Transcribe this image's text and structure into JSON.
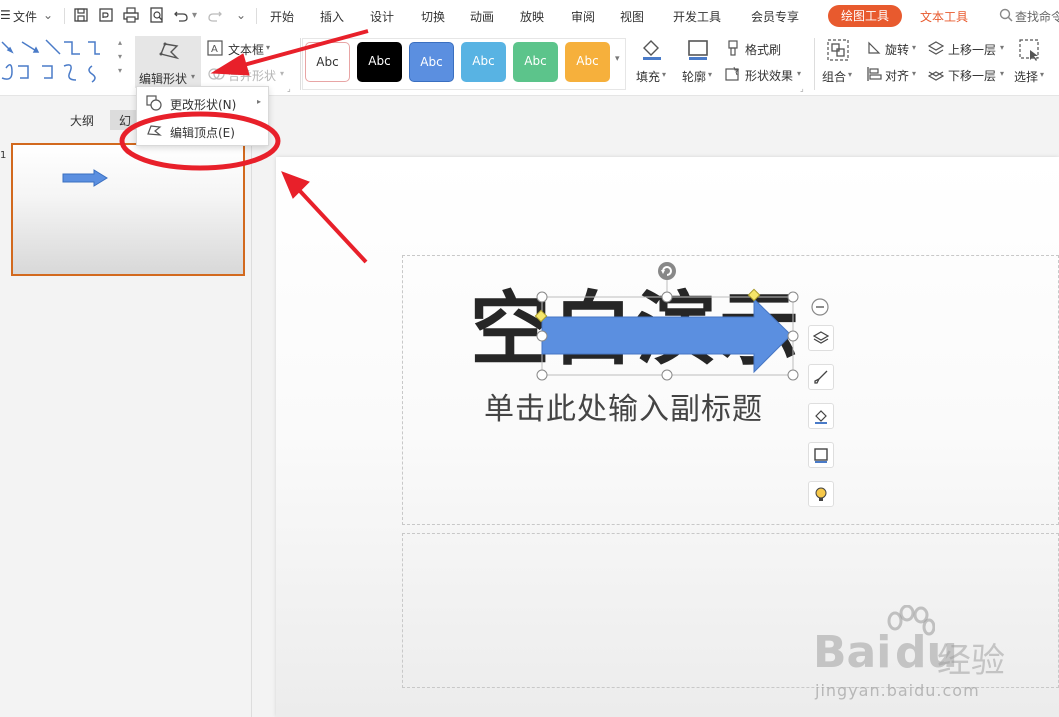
{
  "menubar": {
    "file_label": "文件",
    "items": [
      "开始",
      "插入",
      "设计",
      "切换",
      "动画",
      "放映",
      "审阅",
      "视图",
      "开发工具",
      "会员专享"
    ],
    "drawing_tools_tab": "绘图工具",
    "text_tools_tab": "文本工具",
    "search_placeholder": "查找命令"
  },
  "ribbon": {
    "edit_shape_label": "编辑形状",
    "text_box_label": "文本框",
    "merge_shape_label": "合并形状",
    "style_sample_text": "Abc",
    "fill_label": "填充",
    "outline_label": "轮廓",
    "format_painter_label": "格式刷",
    "shape_effect_label": "形状效果",
    "group_label": "组合",
    "rotate_label": "旋转",
    "align_label": "对齐",
    "bring_forward_label": "上移一层",
    "send_backward_label": "下移一层",
    "select_label": "选择"
  },
  "dropdown": {
    "change_shape_label": "更改形状(N)",
    "edit_points_label": "编辑顶点(E)"
  },
  "leftpane": {
    "outline_tab": "大纲",
    "slides_tab": "幻",
    "slide_number": "1"
  },
  "slide": {
    "title": "空白演示",
    "subtitle": "单击此处输入副标题"
  },
  "watermark": {
    "brand": "Bai",
    "brand2": "du",
    "jingyan": "经验",
    "url": "jingyan.baidu.com"
  },
  "colors": {
    "accent_orange": "#e85a2e",
    "arrow_fill": "#5b8fe0",
    "annotation_red": "#e8202a"
  }
}
